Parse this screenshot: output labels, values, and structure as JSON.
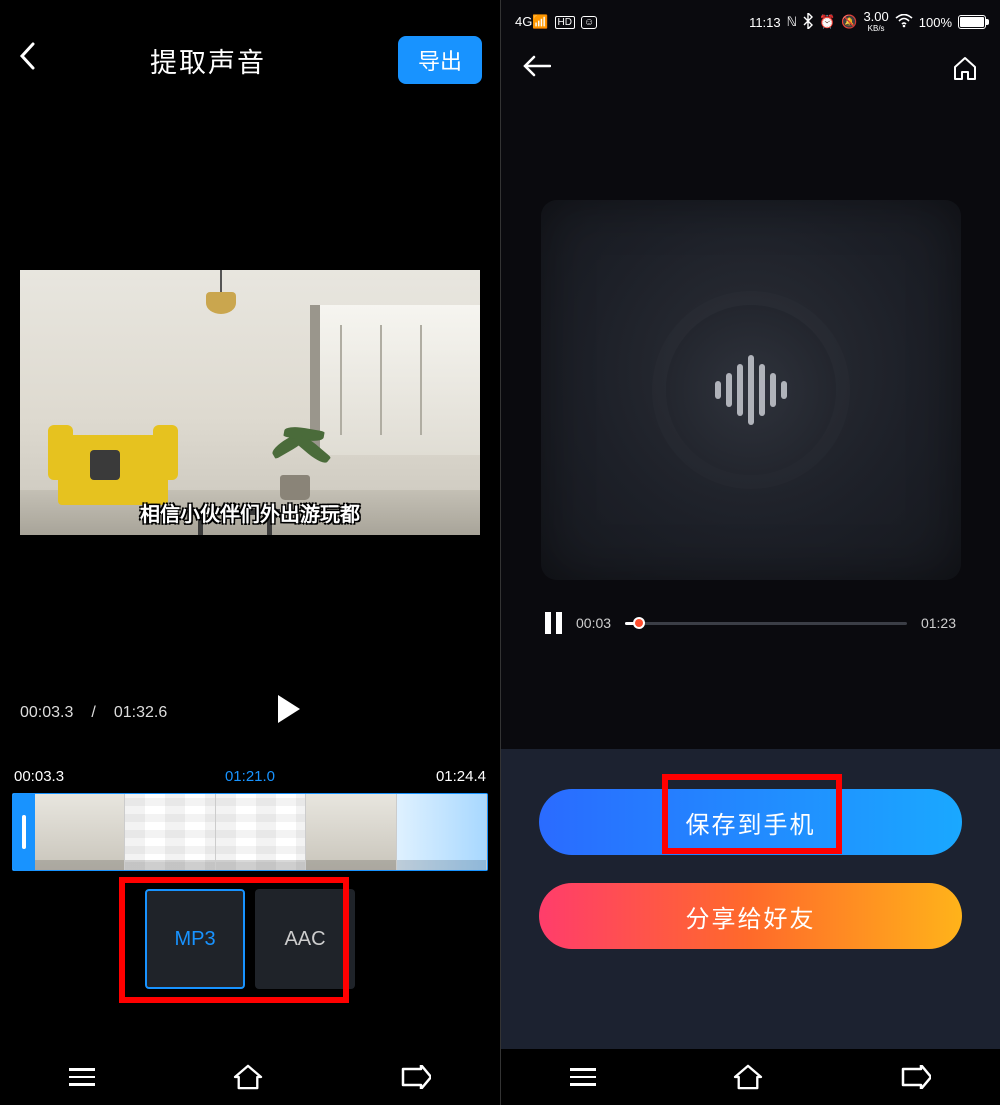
{
  "left": {
    "title": "提取声音",
    "export": "导出",
    "caption": "相信小伙伴们外出游玩都",
    "current_time": "00:03.3",
    "total_time": "01:32.6",
    "tl_start": "00:03.3",
    "tl_mid": "01:21.0",
    "tl_end": "01:24.4",
    "format_mp3": "MP3",
    "format_aac": "AAC"
  },
  "right": {
    "status": {
      "net": "4G",
      "hd": "HD",
      "time": "11:13",
      "speed": "3.00",
      "speed_unit": "KB/s",
      "battery": "100%"
    },
    "player": {
      "cur": "00:03",
      "total": "01:23",
      "progress_pct": 5
    },
    "save": "保存到手机",
    "share": "分享给好友"
  }
}
